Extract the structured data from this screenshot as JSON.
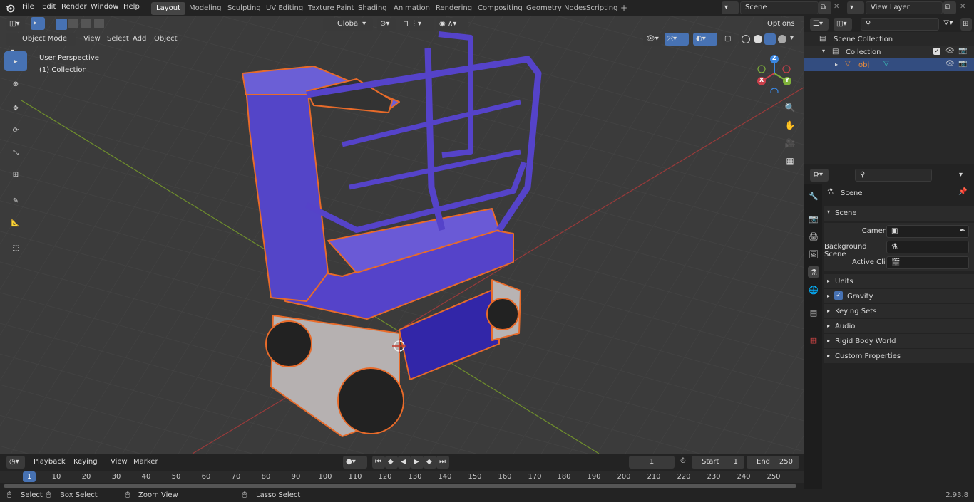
{
  "menus": [
    "File",
    "Edit",
    "Render",
    "Window",
    "Help"
  ],
  "workspaces": [
    "Layout",
    "Modeling",
    "Sculpting",
    "UV Editing",
    "Texture Paint",
    "Shading",
    "Animation",
    "Rendering",
    "Compositing",
    "Geometry Nodes",
    "Scripting"
  ],
  "scene_field": "Scene",
  "view_layer_field": "View Layer",
  "viewport": {
    "mode": "Object Mode",
    "menus": [
      "View",
      "Select",
      "Add",
      "Object"
    ],
    "orientation": "Global",
    "options": "Options",
    "overlay_title": "User Perspective",
    "overlay_collection": "(1) Collection",
    "gizmo_axes": {
      "z": "Z",
      "y": "Y",
      "x": "X"
    }
  },
  "outliner": {
    "scene_collection": "Scene Collection",
    "collection": "Collection",
    "object": "obj"
  },
  "properties": {
    "context": "Scene",
    "section": "Scene",
    "camera_label": "Camera",
    "bg_scene_label": "Background Scene",
    "active_clip_label": "Active Clip",
    "panels": [
      "Units",
      "Gravity",
      "Keying Sets",
      "Audio",
      "Rigid Body World",
      "Custom Properties"
    ]
  },
  "timeline": {
    "menus": [
      "Playback",
      "Keying",
      "View",
      "Marker"
    ],
    "current_frame": "1",
    "start_label": "Start",
    "start_value": "1",
    "end_label": "End",
    "end_value": "250",
    "ruler": [
      "1",
      "10",
      "20",
      "30",
      "40",
      "50",
      "60",
      "70",
      "80",
      "90",
      "100",
      "110",
      "120",
      "130",
      "140",
      "150",
      "160",
      "170",
      "180",
      "190",
      "200",
      "210",
      "220",
      "230",
      "240",
      "250"
    ]
  },
  "status": {
    "select": "Select",
    "box_select": "Box Select",
    "zoom_view": "Zoom View",
    "lasso_select": "Lasso Select",
    "version": "2.93.8"
  },
  "colors": {
    "accent": "#4772b3",
    "selection_outline": "#e86b2a",
    "object_blue": "#5543c9",
    "x_axis": "#c93f4a",
    "y_axis": "#7fb23a",
    "z_axis": "#3a86e0"
  }
}
